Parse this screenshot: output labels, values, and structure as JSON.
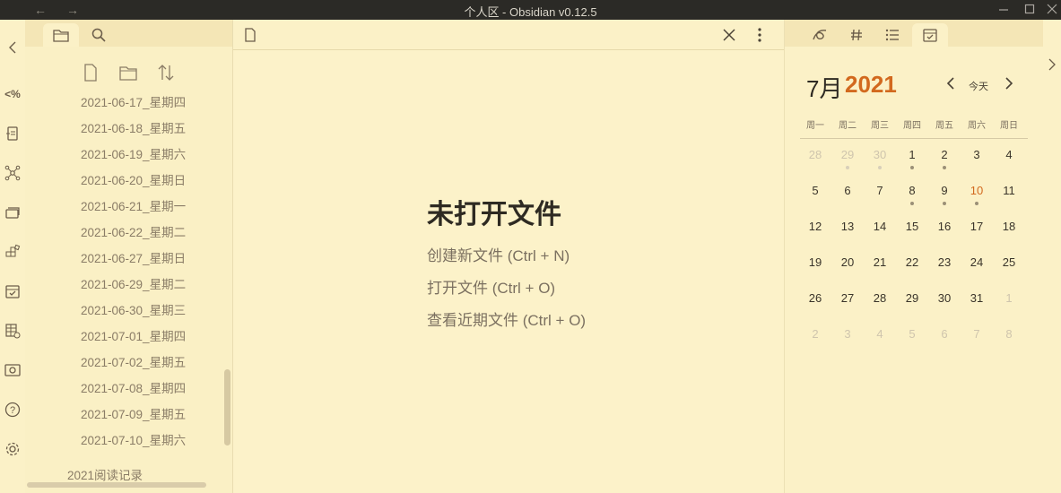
{
  "window": {
    "title": "个人区 - Obsidian v0.12.5"
  },
  "ribbon": {
    "collapse_icon": "chevron-left-icon",
    "items": [
      {
        "name": "templater-icon",
        "text": "<%"
      },
      {
        "name": "note-composer-icon"
      },
      {
        "name": "graph-view-icon"
      },
      {
        "name": "cards-icon"
      },
      {
        "name": "blocks-icon"
      },
      {
        "name": "calendar-check-icon"
      },
      {
        "name": "table-icon"
      },
      {
        "name": "screenshot-icon"
      },
      {
        "name": "help-icon"
      },
      {
        "name": "settings-icon"
      }
    ]
  },
  "left_panel": {
    "tabs": [
      "file-explorer",
      "search"
    ],
    "files": [
      "2021-06-17_星期四",
      "2021-06-18_星期五",
      "2021-06-19_星期六",
      "2021-06-20_星期日",
      "2021-06-21_星期一",
      "2021-06-22_星期二",
      "2021-06-27_星期日",
      "2021-06-29_星期二",
      "2021-06-30_星期三",
      "2021-07-01_星期四",
      "2021-07-02_星期五",
      "2021-07-08_星期四",
      "2021-07-09_星期五",
      "2021-07-10_星期六"
    ],
    "folder": "2021阅读记录"
  },
  "main": {
    "empty_title": "未打开文件",
    "links": [
      "创建新文件 (Ctrl + N)",
      "打开文件 (Ctrl + O)",
      "查看近期文件 (Ctrl + O)"
    ]
  },
  "calendar": {
    "month_label": "7月",
    "year_label": "2021",
    "today_label": "今天",
    "weekdays": [
      "周一",
      "周二",
      "周三",
      "周四",
      "周五",
      "周六",
      "周日"
    ],
    "accent_color": "#d2691e",
    "weeks": [
      [
        {
          "d": "28",
          "m": true
        },
        {
          "d": "29",
          "m": true,
          "dot": true
        },
        {
          "d": "30",
          "m": true,
          "dot": true
        },
        {
          "d": "1",
          "dot": true
        },
        {
          "d": "2",
          "dot": true
        },
        {
          "d": "3"
        },
        {
          "d": "4"
        }
      ],
      [
        {
          "d": "5"
        },
        {
          "d": "6"
        },
        {
          "d": "7"
        },
        {
          "d": "8",
          "dot": true
        },
        {
          "d": "9",
          "dot": true
        },
        {
          "d": "10",
          "today": true,
          "dot": true
        },
        {
          "d": "11"
        }
      ],
      [
        {
          "d": "12"
        },
        {
          "d": "13"
        },
        {
          "d": "14"
        },
        {
          "d": "15"
        },
        {
          "d": "16"
        },
        {
          "d": "17"
        },
        {
          "d": "18"
        }
      ],
      [
        {
          "d": "19"
        },
        {
          "d": "20"
        },
        {
          "d": "21"
        },
        {
          "d": "22"
        },
        {
          "d": "23"
        },
        {
          "d": "24"
        },
        {
          "d": "25"
        }
      ],
      [
        {
          "d": "26"
        },
        {
          "d": "27"
        },
        {
          "d": "28"
        },
        {
          "d": "29"
        },
        {
          "d": "30"
        },
        {
          "d": "31"
        },
        {
          "d": "1",
          "m": true
        }
      ],
      [
        {
          "d": "2",
          "m": true
        },
        {
          "d": "3",
          "m": true
        },
        {
          "d": "4",
          "m": true
        },
        {
          "d": "5",
          "m": true
        },
        {
          "d": "6",
          "m": true
        },
        {
          "d": "7",
          "m": true
        },
        {
          "d": "8",
          "m": true
        }
      ]
    ]
  }
}
